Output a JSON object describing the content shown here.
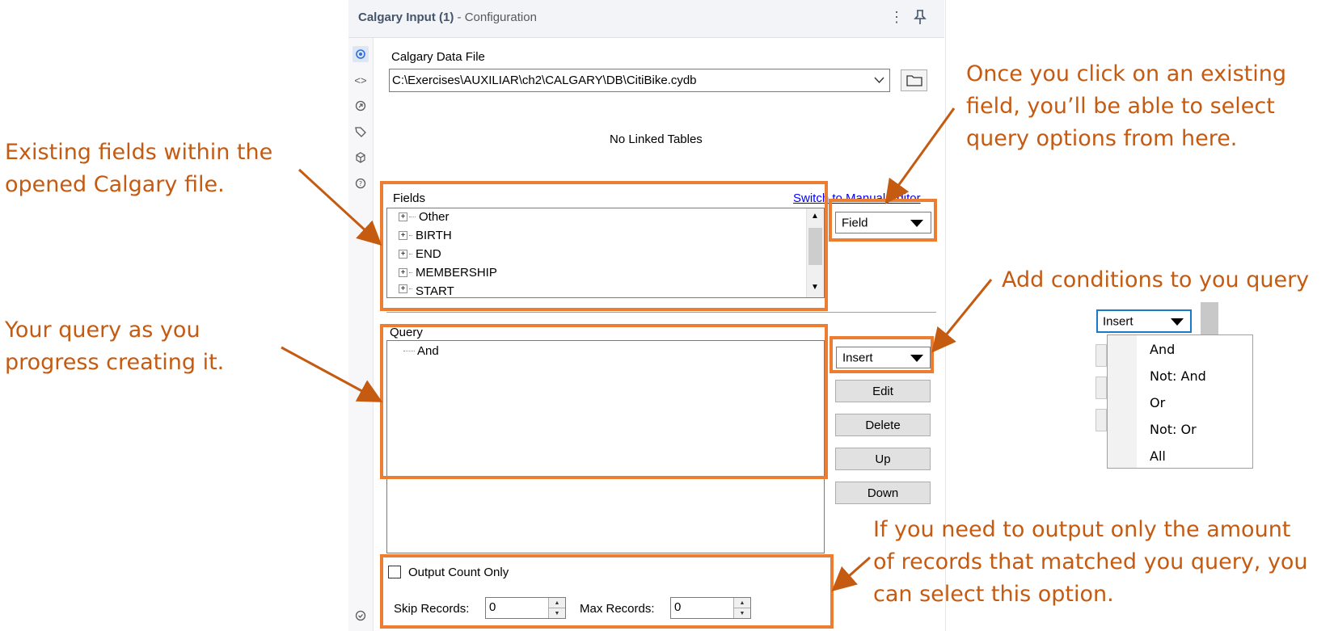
{
  "panel": {
    "title_bold": "Calgary  Input (1)",
    "title_rest": " - Configuration",
    "data_file_label": "Calgary Data File",
    "data_file_path": "C:\\Exercises\\AUXILIAR\\ch2\\CALGARY\\DB\\CitiBike.cydb",
    "no_linked_tables": "No Linked Tables",
    "fields_label": "Fields",
    "switch_link": "Switch to Manual Editor",
    "field_items": [
      "Other",
      "BIRTH",
      "END",
      "MEMBERSHIP",
      "START"
    ],
    "field_dropdown": "Field",
    "query_label": "Query",
    "query_items": [
      "And"
    ],
    "insert_dropdown": "Insert",
    "buttons": {
      "edit": "Edit",
      "delete": "Delete",
      "up": "Up",
      "down": "Down"
    },
    "output_count_only": "Output Count Only",
    "skip_records_label": "Skip Records:",
    "skip_records_value": "0",
    "max_records_label": "Max Records:",
    "max_records_value": "0"
  },
  "insert_menu": {
    "selected": "Insert",
    "options": [
      "And",
      "Not: And",
      "Or",
      "Not: Or",
      "All"
    ]
  },
  "annotations": {
    "fields": [
      "Existing fields within the",
      "opened Calgary file."
    ],
    "query": [
      "Your query as you",
      "progress creating it."
    ],
    "field_options": [
      "Once you click on an existing",
      "field, you’ll be able to select",
      "query options from here."
    ],
    "conditions": [
      "Add conditions to you query"
    ],
    "output": [
      "If you need to output only the amount",
      "of records that matched you query, you",
      "can select this option."
    ]
  },
  "colors": {
    "annotation": "#c55a11",
    "highlight": "#ed7d31",
    "link": "#0000ff"
  }
}
